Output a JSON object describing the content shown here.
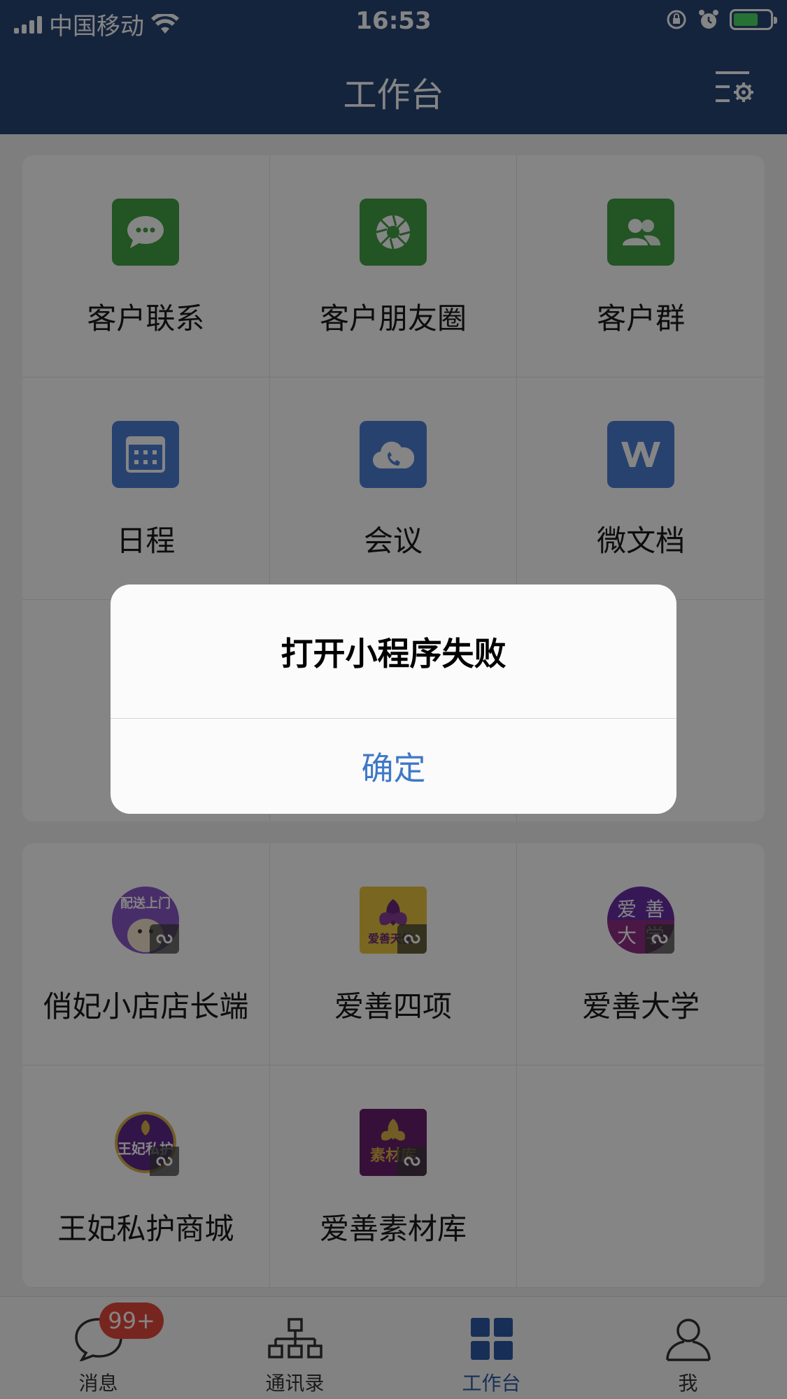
{
  "status_bar": {
    "carrier": "中国移动",
    "time": "16:53"
  },
  "nav": {
    "title": "工作台",
    "settings_icon": "settings-list-icon"
  },
  "apps_top": [
    {
      "label": "客户联系",
      "icon": "chat-bubble-icon",
      "color": "#44a145"
    },
    {
      "label": "客户朋友圈",
      "icon": "aperture-icon",
      "color": "#44a145"
    },
    {
      "label": "客户群",
      "icon": "group-icon",
      "color": "#44a145"
    },
    {
      "label": "日程",
      "icon": "calendar-icon",
      "color": "#4d7fd6"
    },
    {
      "label": "会议",
      "icon": "cloud-phone-icon",
      "color": "#4d7fd6"
    },
    {
      "label": "微文档",
      "icon": "w-doc-icon",
      "color": "#4d7fd6"
    }
  ],
  "mini_programs": [
    {
      "label": "俏妃小店店长端",
      "icon_text": "配送上门"
    },
    {
      "label": "爱善四项",
      "icon_text": "爱善天使"
    },
    {
      "label": "爱善大学",
      "icon_text": "爱善大学"
    },
    {
      "label": "王妃私护商城",
      "icon_text": "王妃私护"
    },
    {
      "label": "爱善素材库",
      "icon_text": "素材库"
    }
  ],
  "tabs": [
    {
      "label": "消息",
      "badge": "99+"
    },
    {
      "label": "通讯录"
    },
    {
      "label": "工作台"
    },
    {
      "label": "我"
    }
  ],
  "dialog": {
    "message": "打开小程序失败",
    "confirm": "确定"
  }
}
